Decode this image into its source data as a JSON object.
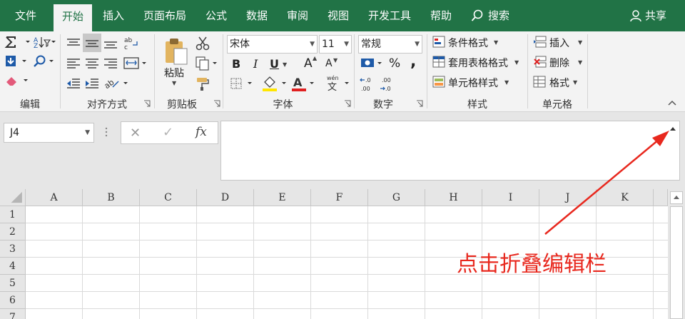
{
  "tabs": [
    {
      "label": "文件",
      "active": false
    },
    {
      "label": "开始",
      "active": true
    },
    {
      "label": "插入",
      "active": false
    },
    {
      "label": "页面布局",
      "active": false
    },
    {
      "label": "公式",
      "active": false
    },
    {
      "label": "数据",
      "active": false
    },
    {
      "label": "审阅",
      "active": false
    },
    {
      "label": "视图",
      "active": false
    },
    {
      "label": "开发工具",
      "active": false
    },
    {
      "label": "帮助",
      "active": false
    }
  ],
  "search": {
    "label": "搜索",
    "icon": "search-icon"
  },
  "share": {
    "label": "共享",
    "icon": "person-icon"
  },
  "ribbon": {
    "groups": {
      "editing": "编辑",
      "alignment": "对齐方式",
      "clipboard": "剪贴板",
      "font": "字体",
      "number": "数字",
      "styles": "样式",
      "cells": "单元格"
    },
    "clipboard": {
      "paste_label": "粘贴"
    },
    "font": {
      "name": "宋体",
      "size": "11",
      "bold": "B",
      "italic": "I",
      "underline": "U",
      "grow": "A",
      "shrink": "A",
      "font_color": "A",
      "phonetic": "wén"
    },
    "number": {
      "format": "常规",
      "percent": "%",
      "comma": ","
    },
    "styles": {
      "conditional": "条件格式",
      "table": "套用表格格式",
      "cell_styles": "单元格样式"
    },
    "cells": {
      "insert": "插入",
      "delete": "删除",
      "format": "格式"
    }
  },
  "formula_bar": {
    "name_box": "J4",
    "cancel": "✕",
    "enter": "✓",
    "fx": "fx",
    "value": ""
  },
  "sheet": {
    "columns": [
      "A",
      "B",
      "C",
      "D",
      "E",
      "F",
      "G",
      "H",
      "I",
      "J",
      "K"
    ],
    "rows": [
      "1",
      "2",
      "3",
      "4",
      "5",
      "6",
      "7"
    ]
  },
  "annotation": {
    "text": "点击折叠编辑栏"
  },
  "colors": {
    "accent": "#217346",
    "annotation": "#e8281e",
    "font_color_bar": "#e02020",
    "fill_color_bar": "#ffe600"
  }
}
